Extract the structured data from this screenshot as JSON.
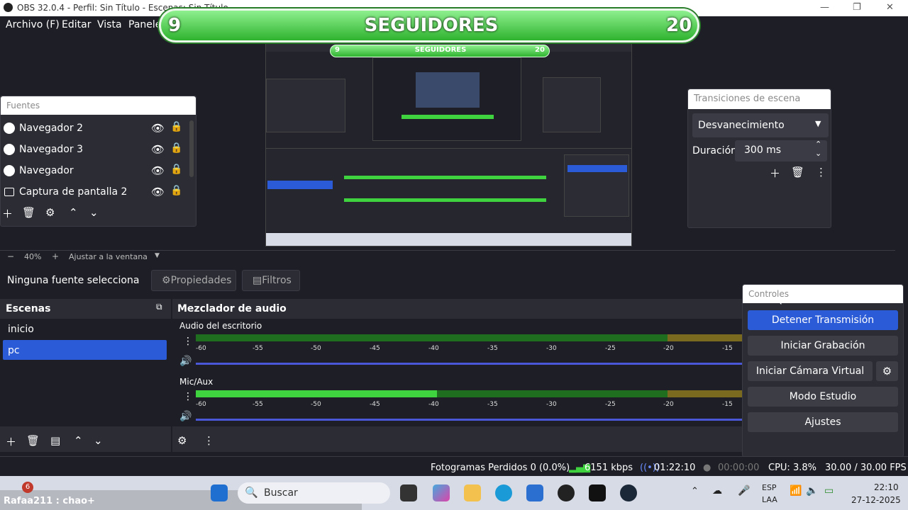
{
  "window": {
    "title": "OBS 32.0.4 - Perfil: Sin Título - Escenas: Sin Título",
    "controls": [
      "—",
      "❐",
      "✕"
    ]
  },
  "menu": [
    "Archivo (F)",
    "Editar",
    "Vista",
    "Paneles"
  ],
  "banner": {
    "left": "9",
    "label": "SEGUIDORES",
    "right": "20"
  },
  "sources": {
    "title": "Fuentes",
    "items": [
      {
        "label": "Navegador 2",
        "icon": "globe-icon"
      },
      {
        "label": "Navegador 3",
        "icon": "globe-icon"
      },
      {
        "label": "Navegador",
        "icon": "globe-icon"
      },
      {
        "label": "Captura de pantalla 2",
        "icon": "monitor-icon"
      }
    ]
  },
  "transitions": {
    "title": "Transiciones de escena",
    "selected": "Desvanecimiento",
    "duration_label": "Duración",
    "duration_value": "300 ms"
  },
  "zoom": {
    "minus": "−",
    "value": "40%",
    "plus": "+",
    "fit": "Ajustar a la ventana"
  },
  "context": {
    "no_source": "Ninguna fuente selecciona",
    "properties": "Propiedades",
    "filters": "Filtros"
  },
  "scenes": {
    "title": "Escenas",
    "items": [
      "inicio",
      "pc"
    ],
    "selected": "pc"
  },
  "mixer": {
    "title": "Mezclador de audio",
    "ticks": [
      "-60",
      "-55",
      "-50",
      "-45",
      "-40",
      "-35",
      "-30",
      "-25",
      "-20",
      "-15"
    ],
    "tracks": [
      {
        "name": "Audio del escritorio",
        "level": 0
      },
      {
        "name": "Mic/Aux",
        "level": 0.55
      }
    ]
  },
  "controls": {
    "title": "Controles",
    "buttons": [
      "Detener Transmisión",
      "Iniciar Grabación",
      "Iniciar Cámara Virtual",
      "Modo Estudio",
      "Ajustes"
    ]
  },
  "status": {
    "dropped": "Fotogramas Perdidos 0 (0.0%)",
    "bitrate": "6151 kbps",
    "stream_time": "01:22:10",
    "rec_time": "00:00:00",
    "cpu": "CPU: 3.8%",
    "fps": "30.00 / 30.00 FPS"
  },
  "taskbar": {
    "notification_badge": "6",
    "user_text": "Rafaa211 : chao+",
    "search": "Buscar",
    "lang_top": "ESP",
    "lang_bottom": "LAA",
    "time": "22:10",
    "date": "27-12-2025"
  },
  "preview_inner": {
    "left": "9",
    "label": "SEGUIDORES",
    "right": "20"
  },
  "colors": {
    "accent": "#2b5bd6",
    "bg": "#1e1f26",
    "panel": "#2b2c34",
    "green": "#3fd43f",
    "slider": "#4a57d6"
  }
}
